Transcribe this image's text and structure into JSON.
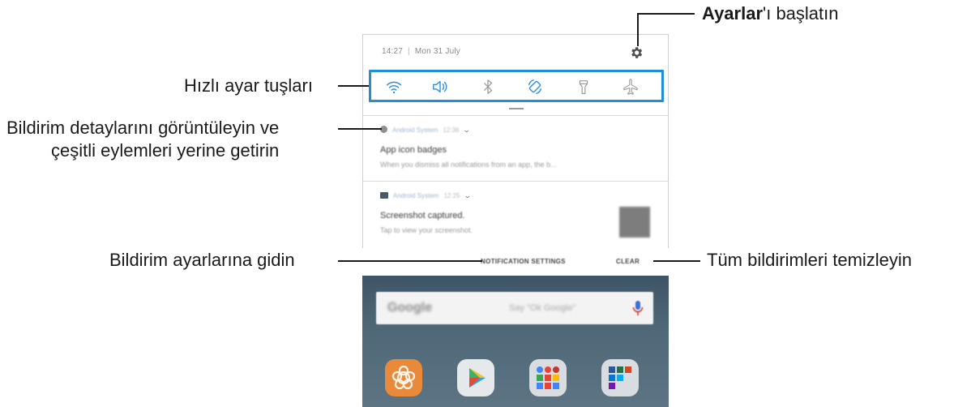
{
  "callouts": {
    "settings_bold": "Ayarlar",
    "settings_rest": "'ı başlatın",
    "quick_settings": "Hızlı ayar tuşları",
    "notification_details_line1": "Bildirim detaylarını görüntüleyin ve",
    "notification_details_line2": "çeşitli eylemleri yerine getirin",
    "notification_settings": "Bildirim ayarlarına gidin",
    "clear_all": "Tüm bildirimleri temizleyin"
  },
  "status_bar": {
    "time": "14:27",
    "date": "Mon 31 July"
  },
  "quick_settings": {
    "buttons": [
      "wifi-icon",
      "sound-icon",
      "bluetooth-icon",
      "auto-rotate-icon",
      "flashlight-icon",
      "airplane-mode-icon"
    ],
    "accent": "#1f8fd8"
  },
  "notifications": [
    {
      "app": "Android System",
      "time": "12:36",
      "title": "App icon badges",
      "body": "When you dismiss all notifications from an app, the b..."
    },
    {
      "app": "Android System",
      "time": "12:25",
      "title": "Screenshot captured.",
      "body": "Tap to view your screenshot."
    }
  ],
  "actions": {
    "notification_settings": "NOTIFICATION SETTINGS",
    "clear": "CLEAR"
  },
  "home": {
    "search_logo": "Google",
    "search_hint": "Say \"Ok Google\"",
    "apps": [
      "galaxy-apps-icon",
      "play-store-icon",
      "google-folder-icon",
      "microsoft-folder-icon"
    ]
  }
}
